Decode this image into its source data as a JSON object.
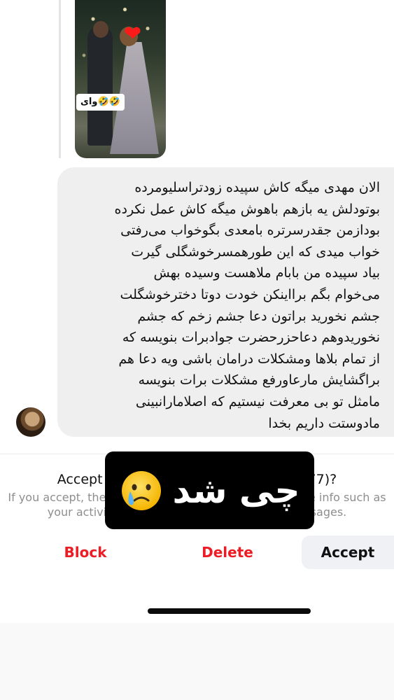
{
  "story_reply": {
    "sticker_text": "وای🤣🤣"
  },
  "message": {
    "text": "الان مهدی میگه کاش سپیده زودتراسلیومرده\nبوتودلش یه بازهم باهوش میگه کاش عمل نکرده\nبودازمن جقدرسرتره بامعدی بگوخواب می‌رفتی\nخواب میدی که این طورهمسرخوشگلی گیرت\nبیاد  سپیده من بابام ملاهست وسیده بهش\nمی‌خوام بگم برااینکن خودت دوتا دخترخوشگلت\nجشم نخورید  براتون دعا جشم زخم که جشم\nنخوریدوهم دعاحزرحضرت جوادبرات بنویسه  که\nاز تمام بلاها ومشکلات درامان باشی ویه دعا هم\nبراگشایش  مارعاورفع مشکلات برات بنویسه\nمامثل تو بی معرفت نیستیم که اصلامارانبینی\nمادوستت داریم بخدا"
  },
  "request": {
    "title": "Accept message request from lalana_77)?",
    "subtitle": "If you accept, they will also be able to call you and see info such as\nyour activity status and when you've read messages."
  },
  "actions": {
    "block": "Block",
    "delete": "Delete",
    "accept": "Accept"
  },
  "overlay": {
    "text": "چی شد",
    "emoji_icon": "sad-tear-face-icon"
  },
  "colors": {
    "danger": "#ed1c24",
    "bubble": "#efefef",
    "accept_bg": "#eff1f5"
  }
}
